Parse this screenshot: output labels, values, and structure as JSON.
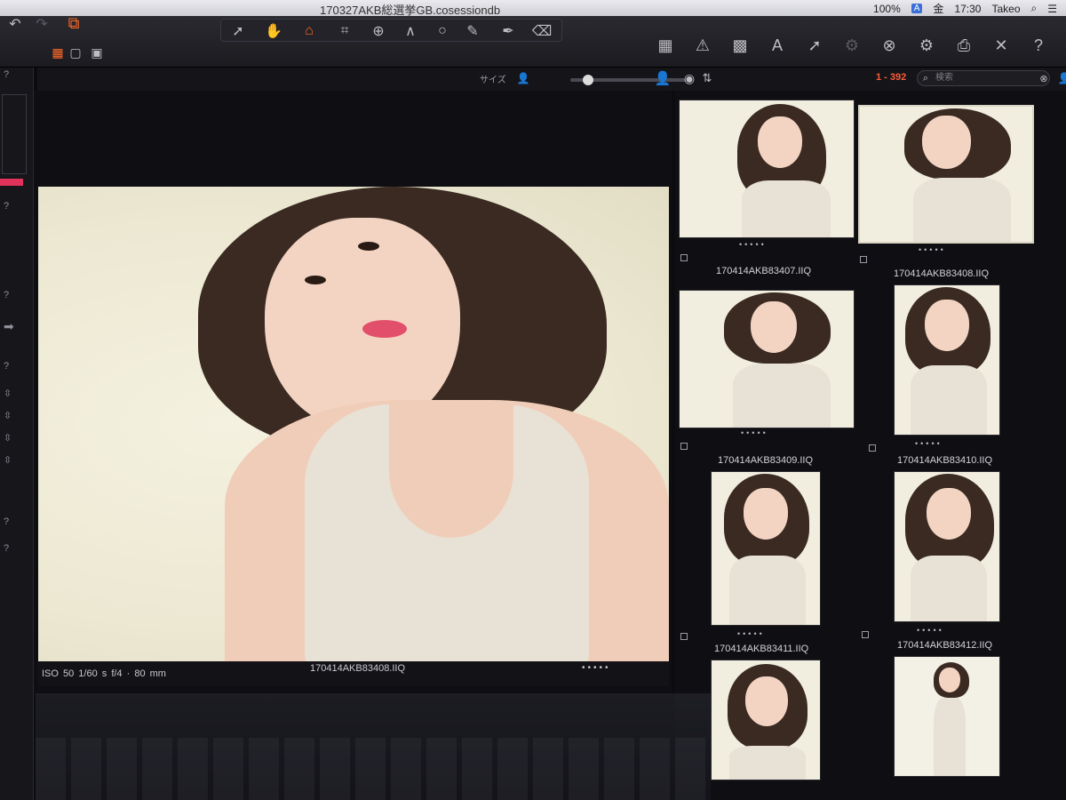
{
  "menubar": {
    "document_title": "170327AKB総選挙GB.cosessiondb",
    "battery": "100%",
    "input_indicator": "A",
    "day": "金",
    "time": "17:30",
    "user": "Takeo"
  },
  "toolbar": {
    "left_icons": [
      "undo-icon",
      "redo-icon",
      "browser-stack-icon"
    ],
    "cursor_tools": [
      "pointer-icon",
      "pan-hand-icon",
      "loupe-icon",
      "crop-icon",
      "rotate-icon",
      "keystone-icon",
      "circle-icon",
      "brush-icon",
      "picker-icon",
      "eraser-icon"
    ],
    "right_icons": [
      "grid-view-icon",
      "warning-icon",
      "checker-icon",
      "text-icon",
      "arrow-icon",
      "gear-icon",
      "close-icon",
      "settings-icon",
      "print-icon",
      "tools-icon",
      "help-icon"
    ]
  },
  "subbar": {
    "size_label": "サイズ",
    "count": "1 - 392",
    "search_placeholder": "検索"
  },
  "viewer": {
    "meta": "ISO 50   1/60 s   f/4 · 80 mm",
    "filename": "170414AKB83408.IIQ",
    "rating_dots": "•••••"
  },
  "thumbnails": [
    {
      "caption": "170414AKB83407.IIQ",
      "selected": false
    },
    {
      "caption": "170414AKB83408.IIQ",
      "selected": true
    },
    {
      "caption": "170414AKB83409.IIQ",
      "selected": false
    },
    {
      "caption": "170414AKB83410.IIQ",
      "selected": false
    },
    {
      "caption": "170414AKB83411.IIQ",
      "selected": false
    },
    {
      "caption": "170414AKB83412.IIQ",
      "selected": false
    }
  ],
  "thumb_rating_dots": "•••••",
  "colors": {
    "accent": "#ff6b2a",
    "count": "#ff5b3a",
    "background": "#0b0b10"
  }
}
